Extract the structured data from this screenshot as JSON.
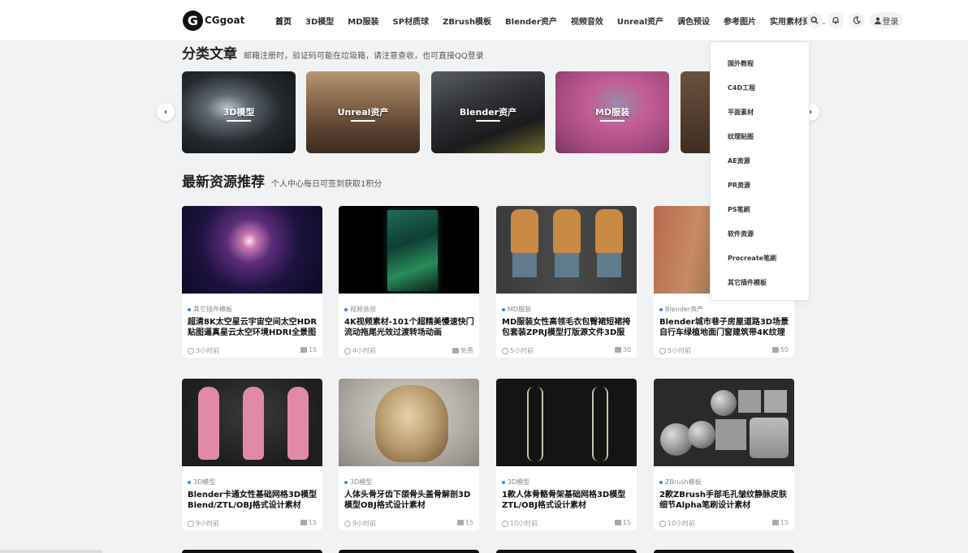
{
  "header": {
    "logo_mark": "G",
    "logo_text": "CGgoat",
    "nav": [
      "首页",
      "3D模型",
      "MD服装",
      "SP材质球",
      "ZBrush模板",
      "Blender资产",
      "视频音效",
      "Unreal资产",
      "调色预设",
      "参考图片",
      "实用素材资产"
    ],
    "login_label": "登录"
  },
  "categories_section": {
    "title": "分类文章",
    "subtitle": "邮箱注册时，验证码可能在垃圾箱，请注意查收，也可直接QQ登录",
    "cards": [
      {
        "label": "3D模型"
      },
      {
        "label": "Unreal资产"
      },
      {
        "label": "Blender资产"
      },
      {
        "label": "MD服装"
      },
      {
        "label": ""
      }
    ]
  },
  "dropdown": {
    "items": [
      "国外教程",
      "C4D工程",
      "平面素材",
      "纹理贴图",
      "AE资源",
      "PR资源",
      "PS笔刷",
      "软件资源",
      "Procreate笔刷",
      "其它插件模板"
    ]
  },
  "latest_section": {
    "title": "最新资源推荐",
    "subtitle": "个人中心每日可签到获取1积分"
  },
  "cards": [
    {
      "category": "其它插件模板",
      "title": "超清8K太空星云宇宙空间太空HDR贴图逼真星云太空环境HDRI全景图",
      "time": "3小时前",
      "points": "15"
    },
    {
      "category": "视频音效",
      "title": "4K视频素材-101个超精美慢速快门流动拖尾光效过渡转场动画",
      "time": "4小时前",
      "points": "免费"
    },
    {
      "category": "MD服装",
      "title": "MD服装女性高领毛衣包臀裙短裙挎包套装ZPRJ模型打版源文件3D服装",
      "time": "5小时前",
      "points": "30"
    },
    {
      "category": "Blender资产",
      "title": "Blender城市巷子房屋道路3D场景自行车绿植地面门窗建筑带4K纹理",
      "time": "5小时前",
      "points": "50"
    },
    {
      "category": "3D模型",
      "title": "Blender卡通女性基础网格3D模型Blend/ZTL/OBJ格式设计素材",
      "time": "9小时前",
      "points": "15"
    },
    {
      "category": "3D模型",
      "title": "人体头骨牙齿下颌骨头盖骨解剖3D模型OBJ格式设计素材",
      "time": "9小时前",
      "points": "15"
    },
    {
      "category": "3D模型",
      "title": "1款人体骨骼骨架基础网格3D模型ZTL/OBJ格式设计素材",
      "time": "10小时前",
      "points": "15"
    },
    {
      "category": "ZBrush模板",
      "title": "2款ZBrush手部毛孔皱纹静脉皮肤细节Alpha笔刷设计素材",
      "time": "10小时前",
      "points": "15"
    }
  ]
}
